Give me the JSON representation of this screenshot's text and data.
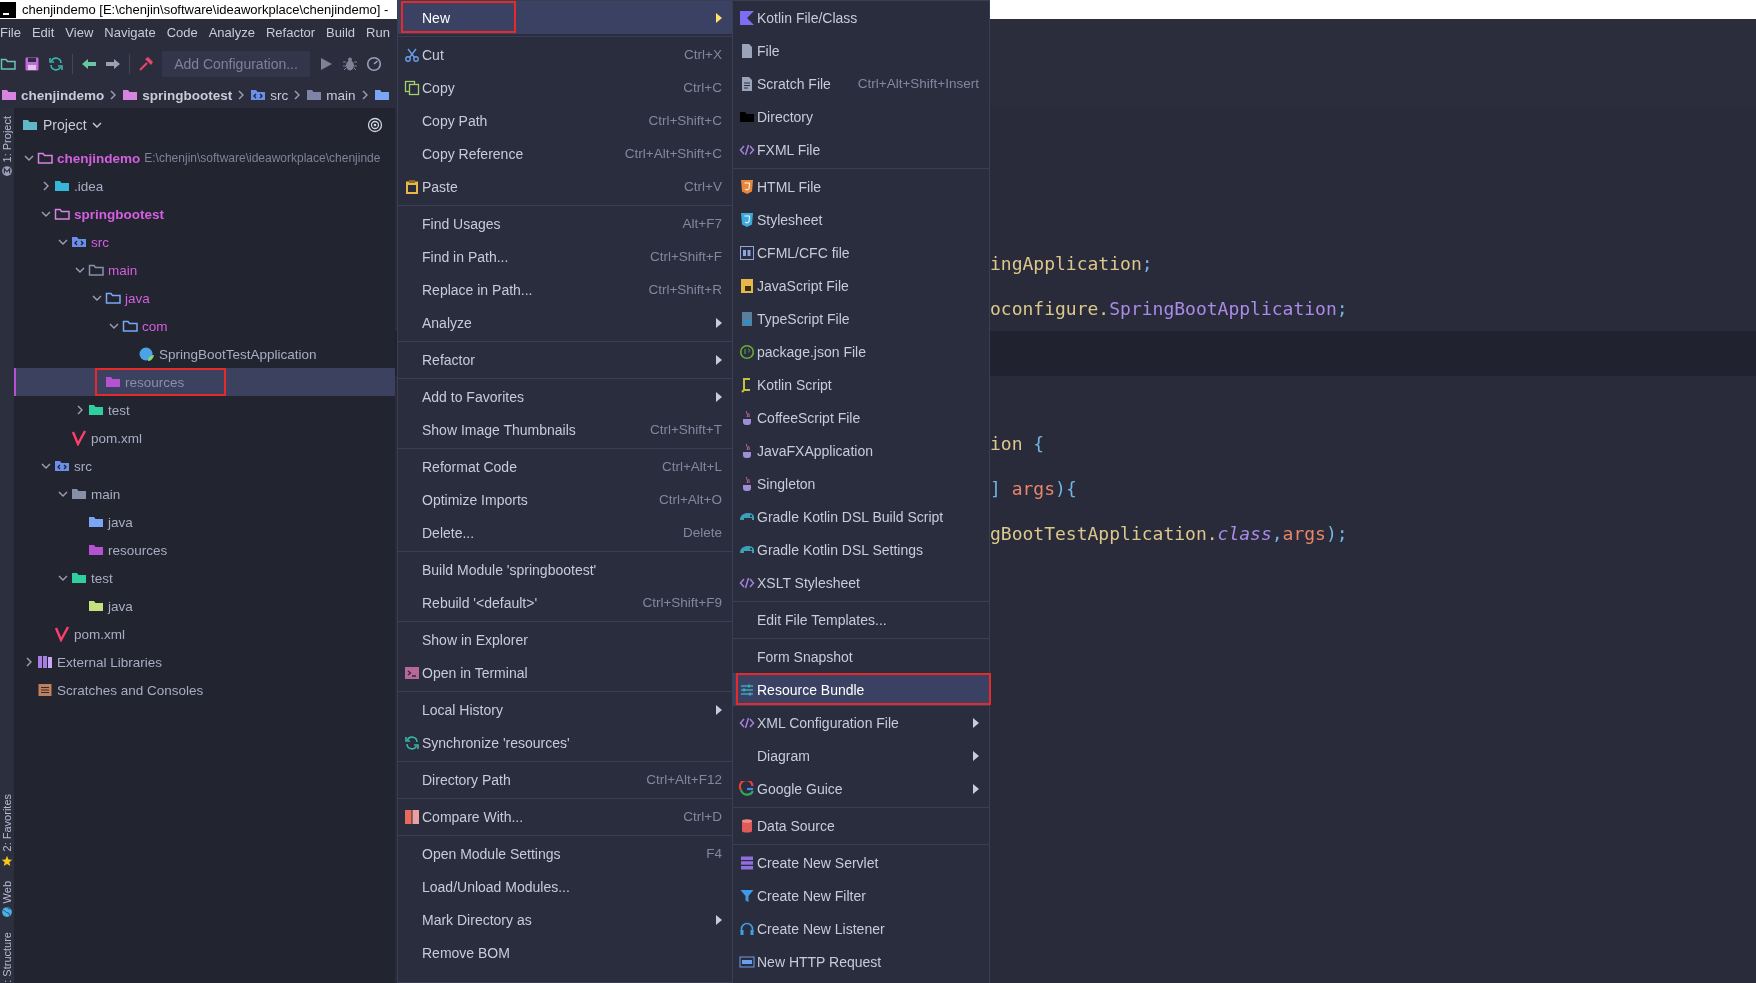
{
  "window": {
    "title": "chenjindemo [E:\\chenjin\\software\\ideaworkplace\\chenjindemo] -"
  },
  "menu_bar": [
    "File",
    "Edit",
    "View",
    "Navigate",
    "Code",
    "Analyze",
    "Refactor",
    "Build",
    "Run"
  ],
  "toolbar": {
    "run_configuration": "Add Configuration..."
  },
  "breadcrumb": [
    {
      "label": "chenjindemo",
      "kind": "module"
    },
    {
      "label": "springbootest",
      "kind": "module"
    },
    {
      "label": "src",
      "kind": "source"
    },
    {
      "label": "main",
      "kind": "folder"
    },
    {
      "kind": "directory"
    }
  ],
  "tool_strip": [
    {
      "label": "1: Project"
    },
    {
      "label": "2: Favorites"
    },
    {
      "label": "Web"
    },
    {
      "label": ": Structure"
    }
  ],
  "project_panel": {
    "title": "Project",
    "tree": [
      {
        "label": "chenjindemo",
        "kind": "module",
        "path": "E:\\chenjin\\software\\ideaworkplace\\chenjinde",
        "expanded": true,
        "highlighted": true,
        "selected": false,
        "children": [
          {
            "label": ".idea",
            "kind": "idea",
            "expanded": false,
            "highlighted": false,
            "selected": false
          },
          {
            "label": "springbootest",
            "kind": "module",
            "expanded": true,
            "highlighted": true,
            "selected": false,
            "children": [
              {
                "label": "src",
                "kind": "source",
                "expanded": true,
                "highlighted": true,
                "selected": false,
                "children": [
                  {
                    "label": "main",
                    "kind": "folder",
                    "expanded": true,
                    "highlighted": true,
                    "selected": false,
                    "children": [
                      {
                        "label": "java",
                        "kind": "java-source",
                        "expanded": true,
                        "highlighted": true,
                        "selected": false,
                        "children": [
                          {
                            "label": "com",
                            "kind": "package",
                            "expanded": true,
                            "highlighted": true,
                            "selected": false,
                            "children": [
                              {
                                "label": "SpringBootTestApplication",
                                "kind": "class",
                                "highlighted": false,
                                "selected": false
                              }
                            ]
                          }
                        ]
                      },
                      {
                        "label": "resources",
                        "kind": "resources",
                        "highlighted": false,
                        "selected": true,
                        "annotated": true
                      }
                    ]
                  },
                  {
                    "label": "test",
                    "kind": "test",
                    "expanded": false,
                    "highlighted": false,
                    "selected": false
                  }
                ]
              },
              {
                "label": "pom.xml",
                "kind": "maven",
                "highlighted": false,
                "selected": false
              }
            ]
          },
          {
            "label": "src",
            "kind": "source",
            "expanded": true,
            "highlighted": false,
            "selected": false,
            "children": [
              {
                "label": "main",
                "kind": "folder",
                "expanded": true,
                "highlighted": false,
                "selected": false,
                "children": [
                  {
                    "label": "java",
                    "kind": "java-source",
                    "highlighted": false,
                    "selected": false
                  },
                  {
                    "label": "resources",
                    "kind": "resources",
                    "highlighted": false,
                    "selected": false
                  }
                ]
              },
              {
                "label": "test",
                "kind": "test",
                "expanded": true,
                "highlighted": false,
                "selected": false,
                "children": [
                  {
                    "label": "java",
                    "kind": "test-java",
                    "highlighted": false,
                    "selected": false
                  }
                ]
              }
            ]
          },
          {
            "label": "pom.xml",
            "kind": "maven",
            "highlighted": false,
            "selected": false
          }
        ]
      },
      {
        "label": "External Libraries",
        "kind": "libraries",
        "expanded": false,
        "highlighted": false,
        "selected": false
      },
      {
        "label": "Scratches and Consoles",
        "kind": "scratches",
        "highlighted": false,
        "selected": false
      }
    ]
  },
  "editor": {
    "lines": [
      {
        "current": false,
        "segments": [
          {
            "text": "ingApplication",
            "kind": "plain"
          },
          {
            "text": ";",
            "kind": "punct"
          }
        ]
      },
      {
        "current": false,
        "segments": [
          {
            "text": "oconfigure.",
            "kind": "plain"
          },
          {
            "text": "SpringBootApplication",
            "kind": "type"
          },
          {
            "text": ";",
            "kind": "punct"
          }
        ]
      },
      {
        "current": true
      },
      {
        "current": false
      },
      {
        "current": false,
        "segments": [
          {
            "text": "ion ",
            "kind": "plain"
          },
          {
            "text": "{",
            "kind": "punct"
          }
        ]
      },
      {
        "current": false,
        "segments": [
          {
            "text": "] ",
            "kind": "punct"
          },
          {
            "text": "args",
            "kind": "param"
          },
          {
            "text": "){",
            "kind": "punct"
          }
        ]
      },
      {
        "current": false,
        "segments": [
          {
            "text": "gBootTestApplication.",
            "kind": "plain"
          },
          {
            "text": "class",
            "kind": "keyword"
          },
          {
            "text": ",",
            "kind": "punct"
          },
          {
            "text": "args",
            "kind": "param"
          },
          {
            "text": ");",
            "kind": "punct"
          }
        ]
      }
    ]
  },
  "context_menu": {
    "groups": [
      [
        {
          "label": "New",
          "has_submenu": true,
          "selected": true,
          "annotated": true
        }
      ],
      [
        {
          "label": "Cut",
          "shortcut": "Ctrl+X",
          "has_submenu": false,
          "selected": false
        },
        {
          "label": "Copy",
          "shortcut": "Ctrl+C",
          "has_submenu": false,
          "selected": false
        },
        {
          "label": "Copy Path",
          "shortcut": "Ctrl+Shift+C",
          "has_submenu": false,
          "selected": false
        },
        {
          "label": "Copy Reference",
          "shortcut": "Ctrl+Alt+Shift+C",
          "has_submenu": false,
          "selected": false
        },
        {
          "label": "Paste",
          "shortcut": "Ctrl+V",
          "has_submenu": false,
          "selected": false
        }
      ],
      [
        {
          "label": "Find Usages",
          "shortcut": "Alt+F7",
          "has_submenu": false,
          "selected": false
        },
        {
          "label": "Find in Path...",
          "shortcut": "Ctrl+Shift+F",
          "has_submenu": false,
          "selected": false
        },
        {
          "label": "Replace in Path...",
          "shortcut": "Ctrl+Shift+R",
          "has_submenu": false,
          "selected": false
        },
        {
          "label": "Analyze",
          "has_submenu": true,
          "selected": false
        }
      ],
      [
        {
          "label": "Refactor",
          "has_submenu": true,
          "selected": false
        }
      ],
      [
        {
          "label": "Add to Favorites",
          "has_submenu": true,
          "selected": false
        },
        {
          "label": "Show Image Thumbnails",
          "shortcut": "Ctrl+Shift+T",
          "has_submenu": false,
          "selected": false
        }
      ],
      [
        {
          "label": "Reformat Code",
          "shortcut": "Ctrl+Alt+L",
          "has_submenu": false,
          "selected": false
        },
        {
          "label": "Optimize Imports",
          "shortcut": "Ctrl+Alt+O",
          "has_submenu": false,
          "selected": false
        },
        {
          "label": "Delete...",
          "shortcut": "Delete",
          "has_submenu": false,
          "selected": false
        }
      ],
      [
        {
          "label": "Build Module 'springbootest'",
          "has_submenu": false,
          "selected": false
        },
        {
          "label": "Rebuild '<default>'",
          "shortcut": "Ctrl+Shift+F9",
          "has_submenu": false,
          "selected": false
        }
      ],
      [
        {
          "label": "Show in Explorer",
          "has_submenu": false,
          "selected": false
        },
        {
          "label": "Open in Terminal",
          "has_submenu": false,
          "selected": false
        }
      ],
      [
        {
          "label": "Local History",
          "has_submenu": true,
          "selected": false
        },
        {
          "label": "Synchronize 'resources'",
          "has_submenu": false,
          "selected": false
        }
      ],
      [
        {
          "label": "Directory Path",
          "shortcut": "Ctrl+Alt+F12",
          "has_submenu": false,
          "selected": false
        }
      ],
      [
        {
          "label": "Compare With...",
          "shortcut": "Ctrl+D",
          "has_submenu": false,
          "selected": false
        }
      ],
      [
        {
          "label": "Open Module Settings",
          "shortcut": "F4",
          "has_submenu": false,
          "selected": false
        },
        {
          "label": "Load/Unload Modules...",
          "has_submenu": false,
          "selected": false
        },
        {
          "label": "Mark Directory as",
          "has_submenu": true,
          "selected": false
        },
        {
          "label": "Remove BOM",
          "has_submenu": false,
          "selected": false
        }
      ]
    ]
  },
  "new_submenu": {
    "groups": [
      [
        {
          "label": "Kotlin File/Class",
          "has_submenu": false,
          "selected": false
        },
        {
          "label": "File",
          "has_submenu": false,
          "selected": false
        },
        {
          "label": "Scratch File",
          "shortcut": "Ctrl+Alt+Shift+Insert",
          "has_submenu": false,
          "selected": false
        },
        {
          "label": "Directory",
          "has_submenu": false,
          "selected": false
        },
        {
          "label": "FXML File",
          "has_submenu": false,
          "selected": false
        }
      ],
      [
        {
          "label": "HTML File",
          "has_submenu": false,
          "selected": false
        },
        {
          "label": "Stylesheet",
          "has_submenu": false,
          "selected": false
        },
        {
          "label": "CFML/CFC file",
          "has_submenu": false,
          "selected": false
        },
        {
          "label": "JavaScript File",
          "has_submenu": false,
          "selected": false
        },
        {
          "label": "TypeScript File",
          "has_submenu": false,
          "selected": false
        },
        {
          "label": "package.json File",
          "has_submenu": false,
          "selected": false
        },
        {
          "label": "Kotlin Script",
          "has_submenu": false,
          "selected": false
        },
        {
          "label": "CoffeeScript File",
          "has_submenu": false,
          "selected": false
        },
        {
          "label": "JavaFXApplication",
          "has_submenu": false,
          "selected": false
        },
        {
          "label": "Singleton",
          "has_submenu": false,
          "selected": false
        },
        {
          "label": "Gradle Kotlin DSL Build Script",
          "has_submenu": false,
          "selected": false
        },
        {
          "label": "Gradle Kotlin DSL Settings",
          "has_submenu": false,
          "selected": false
        },
        {
          "label": "XSLT Stylesheet",
          "has_submenu": false,
          "selected": false
        }
      ],
      [
        {
          "label": "Edit File Templates...",
          "has_submenu": false,
          "selected": false
        }
      ],
      [
        {
          "label": "Form Snapshot",
          "has_submenu": false,
          "selected": false
        },
        {
          "label": "Resource Bundle",
          "has_submenu": false,
          "selected": true,
          "annotated": true
        },
        {
          "label": "XML Configuration File",
          "has_submenu": true,
          "selected": false
        },
        {
          "label": "Diagram",
          "has_submenu": true,
          "selected": false
        },
        {
          "label": "Google Guice",
          "has_submenu": true,
          "selected": false
        }
      ],
      [
        {
          "label": "Data Source",
          "has_submenu": false,
          "selected": false
        }
      ],
      [
        {
          "label": "Create New Servlet",
          "has_submenu": false,
          "selected": false
        },
        {
          "label": "Create New Filter",
          "has_submenu": false,
          "selected": false
        },
        {
          "label": "Create New Listener",
          "has_submenu": false,
          "selected": false
        },
        {
          "label": "New HTTP Request",
          "has_submenu": false,
          "selected": false
        }
      ]
    ]
  }
}
